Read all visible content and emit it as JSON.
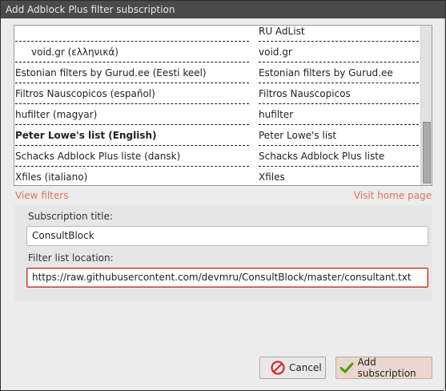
{
  "window": {
    "title": "Add Adblock Plus filter subscription"
  },
  "list": {
    "rows": [
      {
        "name": "",
        "title": "RU AdList",
        "indent": true,
        "bold": false
      },
      {
        "name": "void.gr (ελληνικά)",
        "title": "void.gr",
        "indent": true,
        "bold": false
      },
      {
        "name": "Estonian filters by Gurud.ee (Eesti keel)",
        "title": "Estonian filters by Gurud.ee",
        "indent": false,
        "bold": false
      },
      {
        "name": "Filtros Nauscopicos (español)",
        "title": "Filtros Nauscopicos",
        "indent": false,
        "bold": false
      },
      {
        "name": "hufilter (magyar)",
        "title": "hufilter",
        "indent": false,
        "bold": false
      },
      {
        "name": "Peter Lowe's list (English)",
        "title": "Peter Lowe's list",
        "indent": false,
        "bold": true
      },
      {
        "name": "Schacks Adblock Plus liste (dansk)",
        "title": "Schacks Adblock Plus liste",
        "indent": false,
        "bold": false
      },
      {
        "name": "Xfiles (italiano)",
        "title": "Xfiles",
        "indent": false,
        "bold": false
      }
    ]
  },
  "links": {
    "view_filters": "View filters",
    "visit_home": "Visit home page"
  },
  "form": {
    "title_label": "Subscription title:",
    "title_value": "ConsultBlock",
    "location_label": "Filter list location:",
    "location_value": "https://raw.githubusercontent.com/devmru/ConsultBlock/master/consultant.txt"
  },
  "buttons": {
    "cancel": "Cancel",
    "add": "Add subscription"
  },
  "colors": {
    "accent_link": "#e0735c",
    "invalid_border": "#c0392b",
    "cancel_icon": "#d22b2b",
    "add_icon": "#4e9a06"
  },
  "icons": {
    "cancel": "no-entry-icon",
    "add": "checkmark-icon"
  }
}
